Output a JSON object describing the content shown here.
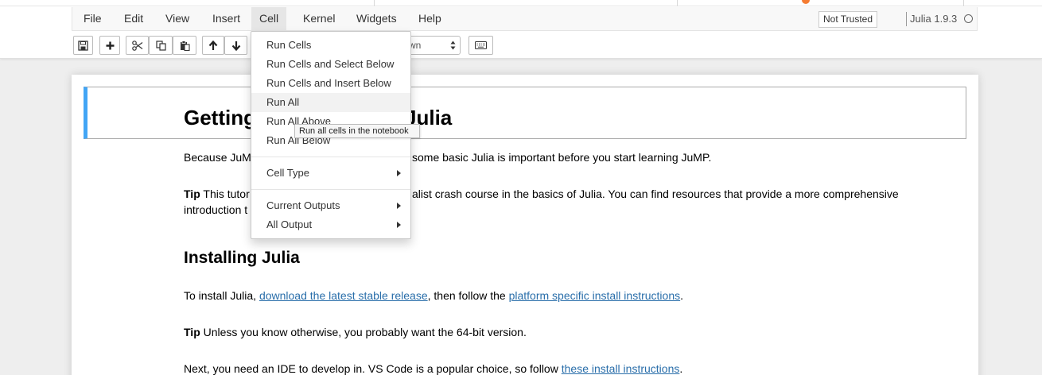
{
  "menubar": {
    "items": [
      "File",
      "Edit",
      "View",
      "Insert",
      "Cell",
      "Kernel",
      "Widgets",
      "Help"
    ],
    "trust_label": "Not Trusted",
    "kernel_name": "Julia 1.9.3"
  },
  "toolbar": {
    "buttons": [
      "save-icon",
      "plus-icon",
      "cut-icon",
      "copy-icon",
      "paste-icon",
      "arrow-up-icon",
      "arrow-down-icon",
      "keyboard-icon"
    ],
    "cell_type_partial": "wn"
  },
  "cell_menu": {
    "items": [
      "Run Cells",
      "Run Cells and Select Below",
      "Run Cells and Insert Below",
      "Run All",
      "Run All Above",
      "Run All Below"
    ],
    "submenus": [
      "Cell Type",
      "Current Outputs",
      "All Output"
    ]
  },
  "tooltip": "Run all cells in the notebook",
  "notebook": {
    "h1_left": "Getting",
    "h1_right": "Julia",
    "p1_left": "Because JuM",
    "p1_right": "some basic Julia is important before you start learning JuMP.",
    "tip_label": "Tip",
    "p2_left": " This tutor",
    "p2_right": "alist crash course in the basics of Julia. You can find resources that provide a more comprehensive",
    "p2_line2": "introduction t",
    "h2": "Installing Julia",
    "p3_pre": "To install Julia, ",
    "p3_link1": "download the latest stable release",
    "p3_mid": ", then follow the ",
    "p3_link2": "platform specific install instructions",
    "p3_post": ".",
    "tip2_label": "Tip",
    "tip2_text": " Unless you know otherwise, you probably want the 64-bit version.",
    "p5_pre": "Next, you need an IDE to develop in. VS Code is a popular choice, so follow ",
    "p5_link": "these install instructions",
    "p5_post": "."
  },
  "colors": {
    "accent_blue": "#42a5f5",
    "link": "#296eaa",
    "tab_indicator": "#f57c32"
  }
}
